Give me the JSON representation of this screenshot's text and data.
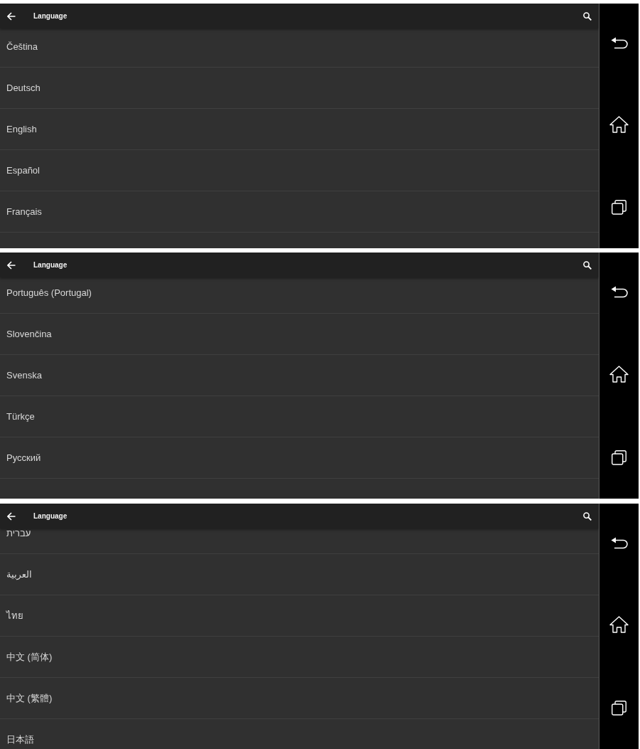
{
  "screens": [
    {
      "app_bar": {
        "title": "Language"
      },
      "languages": [
        "Čeština",
        "Deutsch",
        "English",
        "Español",
        "Français"
      ]
    },
    {
      "app_bar": {
        "title": "Language"
      },
      "languages": [
        "Português (Portugal)",
        "Slovenčina",
        "Svenska",
        "Türkçe",
        "Русский"
      ]
    },
    {
      "app_bar": {
        "title": "Language"
      },
      "languages": [
        "עברית",
        "العربية",
        "ไทย",
        "中文 (简体)",
        "中文 (繁體)",
        "日本語"
      ]
    }
  ]
}
